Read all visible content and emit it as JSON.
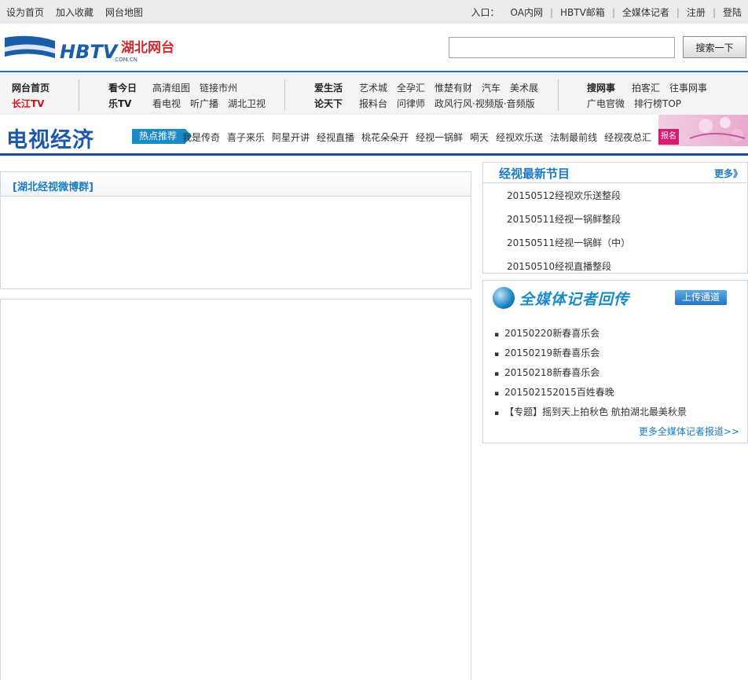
{
  "topbar": {
    "left_links": [
      "设为首页",
      "加入收藏",
      "网台地图"
    ],
    "entry_label": "入口：",
    "right_links": [
      "OA内网",
      "HBTV邮箱",
      "全媒体记者",
      "注册",
      "登陆"
    ]
  },
  "header": {
    "logo_text": "HBTV",
    "logo_sub": "湖北网台",
    "logo_domain": ".COM.CN",
    "search_placeholder": "",
    "search_button": "搜索一下"
  },
  "nav": {
    "col1": [
      "网台首页",
      "长江TV"
    ],
    "col2_heads": [
      "看今日",
      "乐TV"
    ],
    "col2_row1": [
      "高清组图",
      "链接市州"
    ],
    "col2_row2": [
      "看电视",
      "听广播",
      "湖北卫视"
    ],
    "col3_heads": [
      "爱生活",
      "论天下"
    ],
    "col3_row1": [
      "艺术城",
      "全孕汇",
      "惟楚有财",
      "汽车",
      "美术展"
    ],
    "col3_row2": [
      "报料台",
      "问律师",
      "政风行风·视频版·音频版"
    ],
    "col4_head": "搜网事",
    "col4_row1": [
      "拍客汇",
      "往事网事"
    ],
    "col4_row2": [
      "广电官微",
      "排行榜TOP"
    ]
  },
  "channel": {
    "title": "电视经济",
    "hot_label": "热点推荐",
    "links": [
      "我是传奇",
      "喜子来乐",
      "阿星开讲",
      "经视直播",
      "桃花朵朵开",
      "经视一锅鲜",
      "嗬天",
      "经视欢乐送",
      "法制最前线",
      "经视夜总汇"
    ],
    "banner_tag": "报名"
  },
  "weibo": {
    "title": "[湖北经视微博群]"
  },
  "latest": {
    "title": "经视最新节目",
    "more": "更多》",
    "items": [
      "20150512经视欢乐送整段",
      "20150511经视一锅鲜整段",
      "20150511经视一锅鲜（中）",
      "20150510经视直播整段"
    ]
  },
  "reporter": {
    "title": "全媒体记者回传",
    "upload": "上传通道",
    "items": [
      "20150220新春喜乐会",
      "20150219新春喜乐会",
      "20150218新春喜乐会",
      "201502152015百姓春晚",
      "【专题】摇到天上拍秋色 航拍湖北最美秋景"
    ],
    "more": "更多全媒体记者报道>>"
  },
  "colors": {
    "brand_blue": "#1a7bc4",
    "nav_border": "#2a6cb3",
    "red": "#c8161d"
  }
}
